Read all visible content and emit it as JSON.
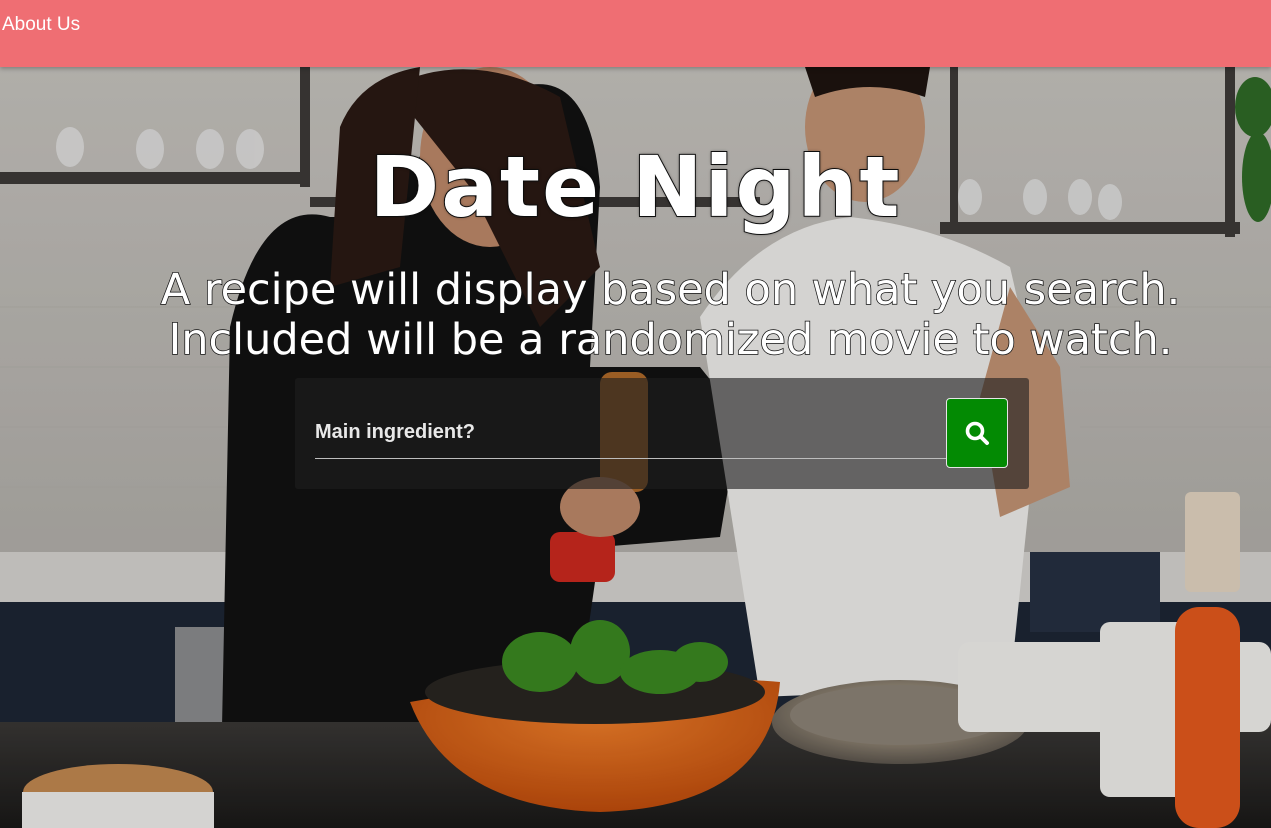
{
  "navbar": {
    "about_label": "About Us",
    "background_color": "#ef6e73"
  },
  "hero": {
    "title": "Date Night",
    "subtitle_line1": "A recipe will display based on what you search.",
    "subtitle_line2": "Included will be a randomized movie to watch."
  },
  "search": {
    "placeholder": "Main ingredient?",
    "value": "",
    "button_icon": "search-icon",
    "button_color": "#038a03"
  }
}
